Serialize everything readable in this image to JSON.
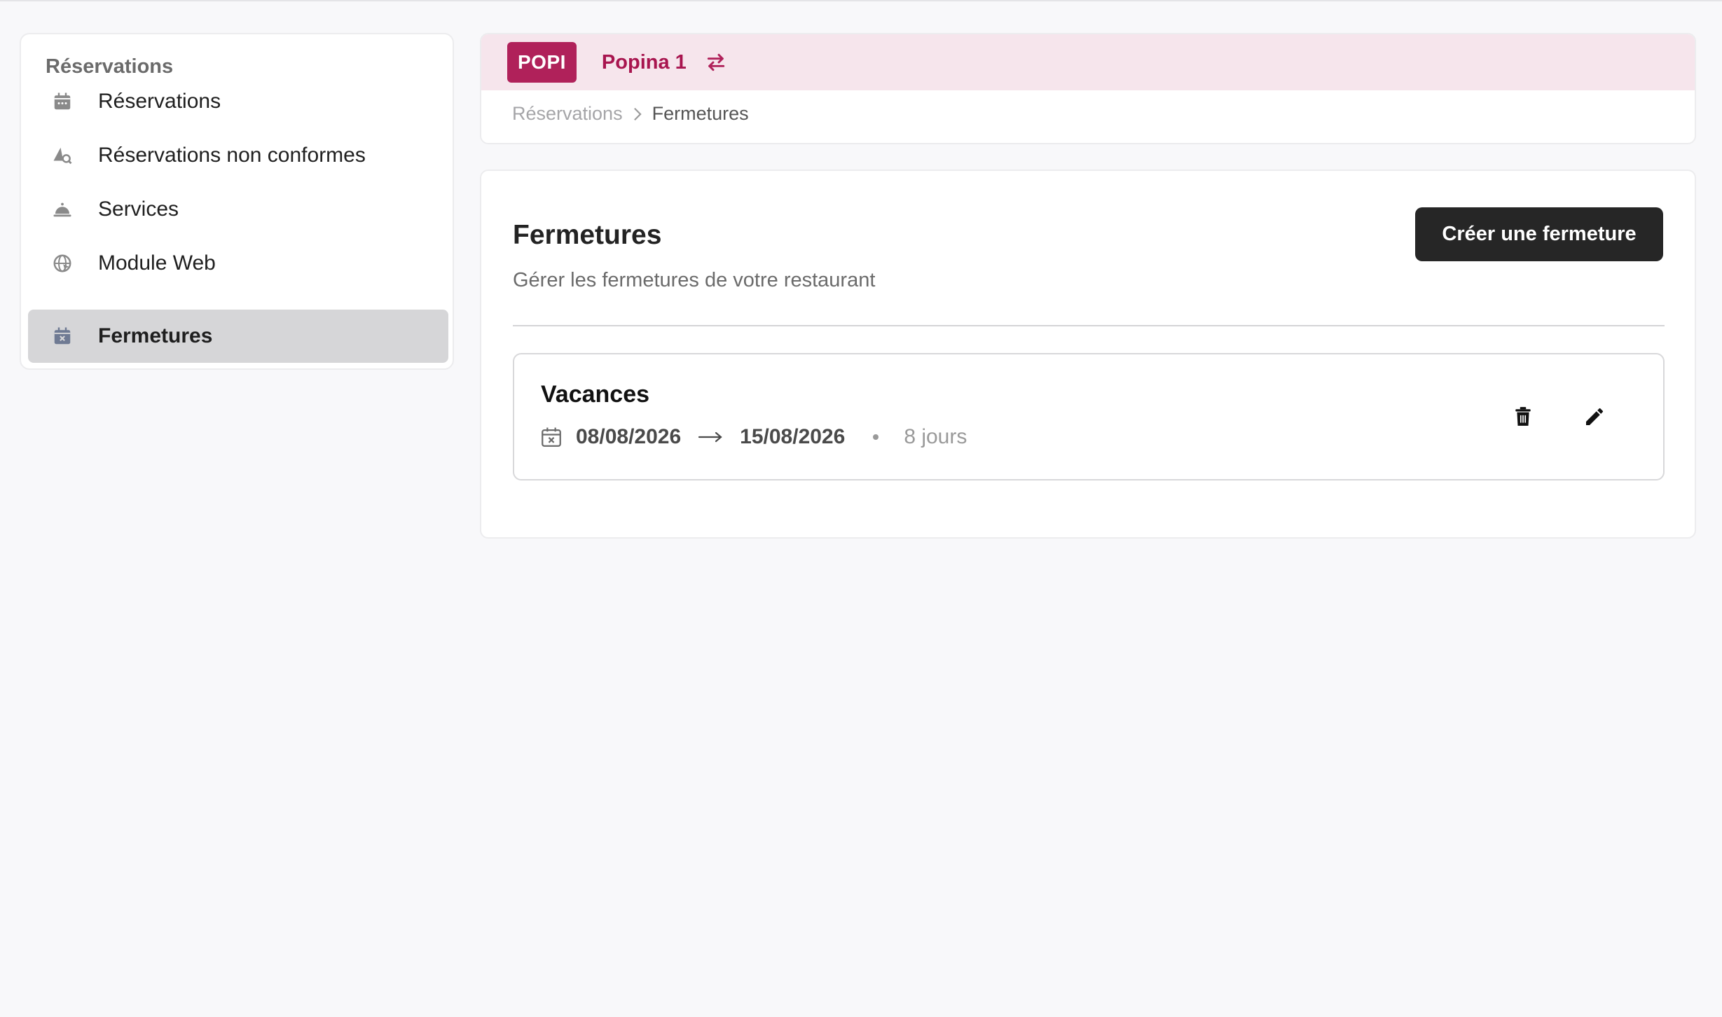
{
  "sidebar": {
    "title": "Réservations",
    "items": [
      {
        "label": "Réservations",
        "icon": "calendar-icon"
      },
      {
        "label": "Réservations non conformes",
        "icon": "alert-search-icon"
      },
      {
        "label": "Services",
        "icon": "service-bell-icon"
      },
      {
        "label": "Module Web",
        "icon": "globe-icon"
      },
      {
        "label": "Fermetures",
        "icon": "calendar-x-icon",
        "active": true
      }
    ]
  },
  "header": {
    "badge": "POPI",
    "restaurant_name": "Popina 1",
    "switch_icon": "swap-arrows-icon",
    "breadcrumb": [
      "Réservations",
      "Fermetures"
    ]
  },
  "main": {
    "title": "Fermetures",
    "subtitle": "Gérer les fermetures de votre restaurant",
    "create_button": "Créer une fermeture",
    "closures": [
      {
        "name": "Vacances",
        "start": "08/08/2026",
        "end": "15/08/2026",
        "duration": "8 jours"
      }
    ]
  },
  "colors": {
    "brand": "#b0215a",
    "brand_bar": "#f6e5ec",
    "primary_button": "#262626",
    "active_nav": "#d6d6d8"
  }
}
